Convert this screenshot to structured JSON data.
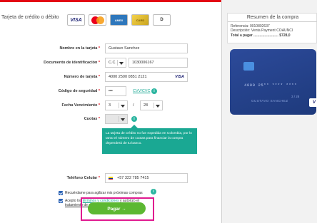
{
  "payment_method": {
    "title": "Tarjeta de crédito o débito"
  },
  "brands": {
    "visa": "VISA",
    "amex_text": "AMEX",
    "diners_text": "D",
    "gold_text": "CARD",
    "selected_brand": "VISA"
  },
  "form": {
    "name_label": "Nombre en la tarjeta",
    "name_value": "Gustavo Sanchez",
    "doc_label": "Documento de identificación",
    "doc_type": "C.C.",
    "doc_value": "1030006167",
    "card_label": "Número de tarjeta",
    "card_value": "4000 2500 0851 2121",
    "card_brand": "VISA",
    "cvv_label": "Código de seguridad",
    "cvv_value": "•••",
    "cvv_link": "CVV/CVC",
    "exp_label": "Fecha Vencimiento",
    "exp_month": "3",
    "exp_sep": "/",
    "exp_year": "28",
    "quotas_label": "Cuotas",
    "quotas_value": "",
    "tooltip": "La tarjeta de crédito no fue expedida en Colombia, por lo tanto el número de cuotas para financiar la compra dependerá de tu banco.",
    "phone_label": "Teléfono Celular",
    "phone_value": "+57 322 785 7415",
    "required_mark": "*"
  },
  "checks": {
    "remember": "Recuérdame para agilizar mis próximas compras",
    "accept_prefix": "Acepto los ",
    "terms_link": "términos y condiciones",
    "accept_middle": " y autorizo el",
    "data_link": "tratamiento de datos personales"
  },
  "pay_button": {
    "label": "Pagar →"
  },
  "summary": {
    "title": "Resumen de la compra",
    "reference": "Referencia: 0010802637",
    "description": "Descripción: Venta Payment COAUNCI",
    "total_label": "Total a pagar .........................",
    "total_value": "$728,0"
  },
  "card_preview": {
    "number": "4000 25** **** ****",
    "expiry": "3 / 28",
    "holder": "GUSTAVO SANCHEZ",
    "brand": "V"
  },
  "colors": {
    "accent": "#e30613",
    "pay_green": "#5cb832",
    "tooltip_teal": "#1aa893",
    "card_blue": "#2c4a9a",
    "highlight_pink": "#e0198f"
  }
}
